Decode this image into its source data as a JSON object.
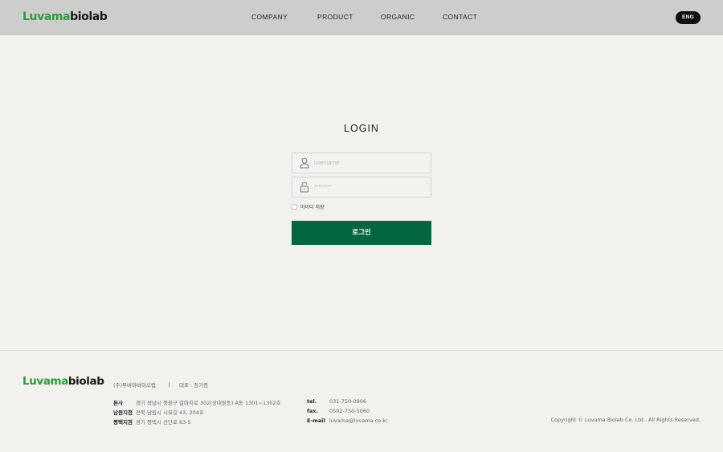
{
  "header": {
    "logo": {
      "part1": "Luvama",
      "part2": "biolab"
    },
    "nav": [
      "COMPANY",
      "PRODUCT",
      "ORGANIC",
      "CONTACT"
    ],
    "lang_button": "ENG"
  },
  "login": {
    "title": "LOGIN",
    "username_placeholder": "username",
    "password_placeholder": "********",
    "remember_label": "아이디 저장",
    "submit_label": "로그인"
  },
  "footer": {
    "logo": {
      "part1": "Luvama",
      "part2": "biolab"
    },
    "company": "(주)루바마바이오랩",
    "separator": "|",
    "ceo": "대표 : 장기종",
    "offices": [
      {
        "label": "본사",
        "address": "경기 성남시 중원구 갈마치로 302(상대원동) A동 1301~1302호"
      },
      {
        "label": "남원지점",
        "address": "전북 남원시 시묘길 43, 204호"
      },
      {
        "label": "평택지점",
        "address": "경기 평택시 산단로 63-5"
      }
    ],
    "contacts": [
      {
        "label": "tel.",
        "value": "031-750-0906"
      },
      {
        "label": "fax.",
        "value": "0502-750-5060"
      },
      {
        "label": "E-mail",
        "value": "luvama@luvama.co.kr"
      }
    ],
    "copyright": "Copyright ©  Luvama Biolab Co. Ltd.. All Rights Reserved."
  },
  "colors": {
    "header_bg": "#cdcdcb",
    "page_bg": "#f2f1ed",
    "brand_green": "#2e9a3c",
    "button_green": "#046640"
  }
}
